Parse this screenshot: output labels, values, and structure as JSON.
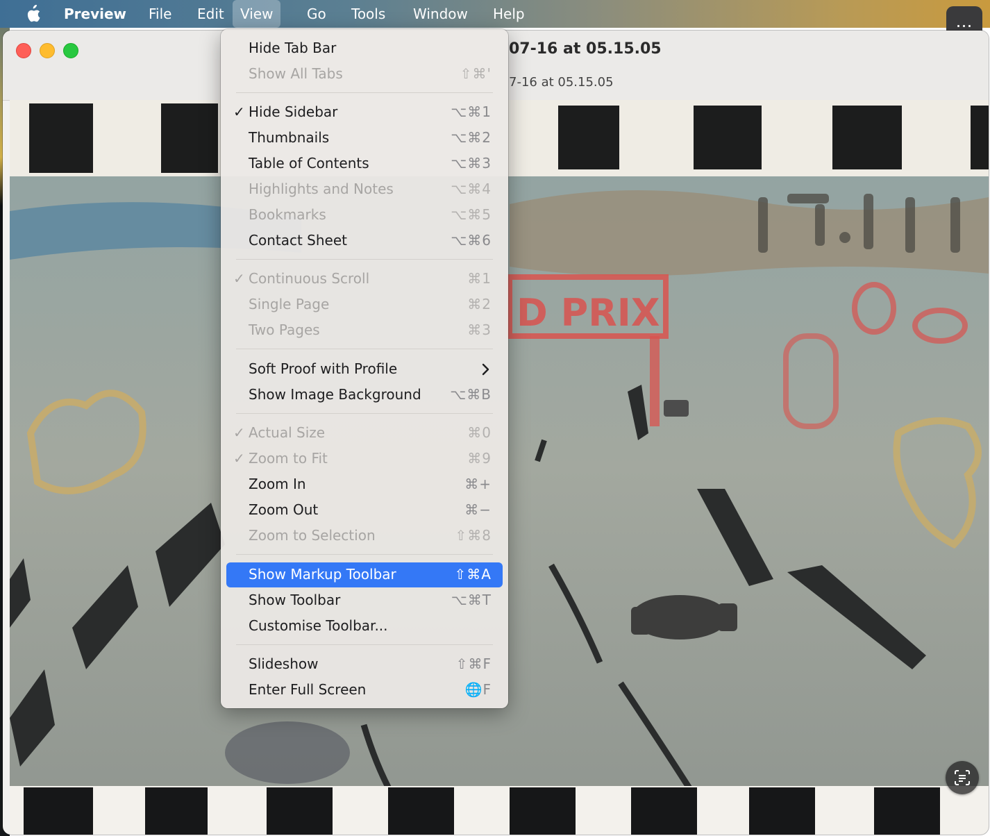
{
  "menubar": {
    "app": "Preview",
    "items": [
      "File",
      "Edit",
      "View",
      "Go",
      "Tools",
      "Window",
      "Help"
    ],
    "active": "View",
    "more_icon": "…"
  },
  "window": {
    "title": "07-16 at 05.15.05",
    "subtitle": "7-16 at 05.15.05"
  },
  "photo": {
    "sign_text": "D PRIX"
  },
  "view_menu": {
    "items": [
      {
        "label": "Hide Tab Bar",
        "shortcut": "",
        "check": "",
        "enabled": true
      },
      {
        "label": "Show All Tabs",
        "shortcut": "⇧⌘'",
        "check": "",
        "enabled": false
      },
      {
        "label": "Hide Sidebar",
        "shortcut": "⌥⌘1",
        "check": "✓",
        "enabled": true
      },
      {
        "label": "Thumbnails",
        "shortcut": "⌥⌘2",
        "check": "",
        "enabled": true
      },
      {
        "label": "Table of Contents",
        "shortcut": "⌥⌘3",
        "check": "",
        "enabled": true
      },
      {
        "label": "Highlights and Notes",
        "shortcut": "⌥⌘4",
        "check": "",
        "enabled": false
      },
      {
        "label": "Bookmarks",
        "shortcut": "⌥⌘5",
        "check": "",
        "enabled": false
      },
      {
        "label": "Contact Sheet",
        "shortcut": "⌥⌘6",
        "check": "",
        "enabled": true
      },
      {
        "label": "Continuous Scroll",
        "shortcut": "⌘1",
        "check": "✓",
        "enabled": false
      },
      {
        "label": "Single Page",
        "shortcut": "⌘2",
        "check": "",
        "enabled": false
      },
      {
        "label": "Two Pages",
        "shortcut": "⌘3",
        "check": "",
        "enabled": false
      },
      {
        "label": "Soft Proof with Profile",
        "shortcut": "",
        "check": "",
        "enabled": true,
        "submenu": true
      },
      {
        "label": "Show Image Background",
        "shortcut": "⌥⌘B",
        "check": "",
        "enabled": true
      },
      {
        "label": "Actual Size",
        "shortcut": "⌘0",
        "check": "✓",
        "enabled": false
      },
      {
        "label": "Zoom to Fit",
        "shortcut": "⌘9",
        "check": "✓",
        "enabled": false
      },
      {
        "label": "Zoom In",
        "shortcut": "⌘+",
        "check": "",
        "enabled": true
      },
      {
        "label": "Zoom Out",
        "shortcut": "⌘−",
        "check": "",
        "enabled": true
      },
      {
        "label": "Zoom to Selection",
        "shortcut": "⇧⌘8",
        "check": "",
        "enabled": false
      },
      {
        "label": "Show Markup Toolbar",
        "shortcut": "⇧⌘A",
        "check": "",
        "enabled": true,
        "highlighted": true
      },
      {
        "label": "Show Toolbar",
        "shortcut": "⌥⌘T",
        "check": "",
        "enabled": true
      },
      {
        "label": "Customise Toolbar...",
        "shortcut": "",
        "check": "",
        "enabled": true
      },
      {
        "label": "Slideshow",
        "shortcut": "⇧⌘F",
        "check": "",
        "enabled": true
      },
      {
        "label": "Enter Full Screen",
        "shortcut": "🌐F",
        "check": "",
        "enabled": true
      }
    ]
  },
  "colors": {
    "menu_highlight": "#3478f6",
    "close": "#fe5f57",
    "minimize": "#febc2e",
    "maximize": "#28c840",
    "sign_red": "#d9534f"
  }
}
